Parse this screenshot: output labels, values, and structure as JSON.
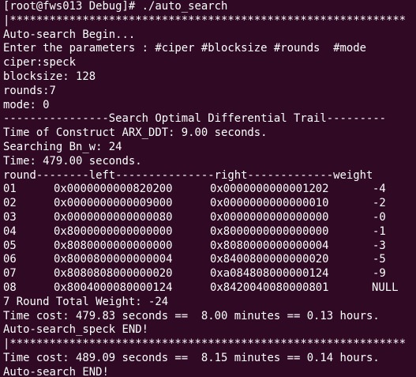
{
  "terminal": {
    "prompt_line": "[root@fws013 Debug]# ./auto_search",
    "star_line_1": "|************************************************************",
    "begin": "Auto-search Begin...",
    "enter_params": "Enter the parameters : #ciper #blocksize #rounds  #mode",
    "cipher": "ciper:speck",
    "blocksize": "blocksize: 128",
    "rounds": "rounds:7",
    "mode": "mode: 0",
    "section_title": "----------------Search Optimal Differential Trail---------",
    "construct_time": "Time of Construct ARX_DDT: 9.00 seconds.",
    "searching": "Searching Bn_w: 24",
    "search_time": "Time: 479.00 seconds.",
    "table_header": "round--------left---------------right-------------weight",
    "rows": [
      {
        "round": "01",
        "left": "0x0000000000820200",
        "right": "0x0000000000001202",
        "weight": "-4"
      },
      {
        "round": "02",
        "left": "0x0000000000009000",
        "right": "0x0000000000000010",
        "weight": "-2"
      },
      {
        "round": "03",
        "left": "0x0000000000000080",
        "right": "0x0000000000000000",
        "weight": "-0"
      },
      {
        "round": "04",
        "left": "0x8000000000000000",
        "right": "0x8000000000000000",
        "weight": "-1"
      },
      {
        "round": "05",
        "left": "0x8080000000000000",
        "right": "0x8080000000000004",
        "weight": "-3"
      },
      {
        "round": "06",
        "left": "0x8000800000000004",
        "right": "0x8400800000000020",
        "weight": "-5"
      },
      {
        "round": "07",
        "left": "0x8080808000000020",
        "right": "0xa084808000000124",
        "weight": "-9"
      },
      {
        "round": "08",
        "left": "0x8004000080000124",
        "right": "0x8420040080000801",
        "weight": "NULL"
      }
    ],
    "total_weight": "7 Round Total Weight: -24",
    "time_cost_1": "Time cost: 479.83 seconds ==  8.00 minutes == 0.13 hours.",
    "speck_end": "Auto-search_speck END!",
    "star_line_2": "|************************************************************",
    "time_cost_2": "Time cost: 489.09 seconds ==  8.15 minutes == 0.14 hours.",
    "end": "Auto-search END!",
    "star_line_3": "|************************************************************"
  }
}
